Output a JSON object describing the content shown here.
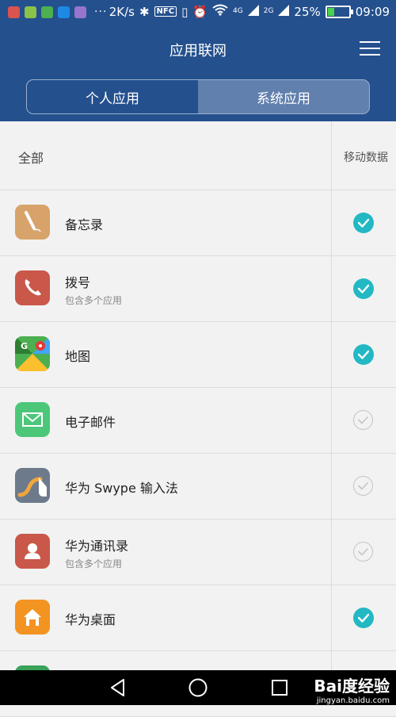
{
  "status_bar": {
    "speed": "2K/s",
    "nfc": "NFC",
    "net_4g": "4G",
    "net_2g": "2G",
    "battery": "25%",
    "time": "09:09"
  },
  "header": {
    "title": "应用联网",
    "tabs": [
      {
        "label": "个人应用",
        "active": false
      },
      {
        "label": "系统应用",
        "active": true
      }
    ]
  },
  "list": {
    "col_all": "全部",
    "col_mobile": "移动数据",
    "apps": [
      {
        "name": "备忘录",
        "sub": "",
        "checked": true
      },
      {
        "name": "拨号",
        "sub": "包含多个应用",
        "checked": true
      },
      {
        "name": "地图",
        "sub": "",
        "checked": true
      },
      {
        "name": "电子邮件",
        "sub": "",
        "checked": false
      },
      {
        "name": "华为 Swype 输入法",
        "sub": "",
        "checked": false
      },
      {
        "name": "华为通讯录",
        "sub": "包含多个应用",
        "checked": false
      },
      {
        "name": "华为桌面",
        "sub": "",
        "checked": true
      }
    ]
  },
  "watermark": {
    "brand": "Bai度经验",
    "url": "jingyan.baidu.com"
  },
  "colors": {
    "header": "#24508e",
    "check": "#22b8c4"
  }
}
